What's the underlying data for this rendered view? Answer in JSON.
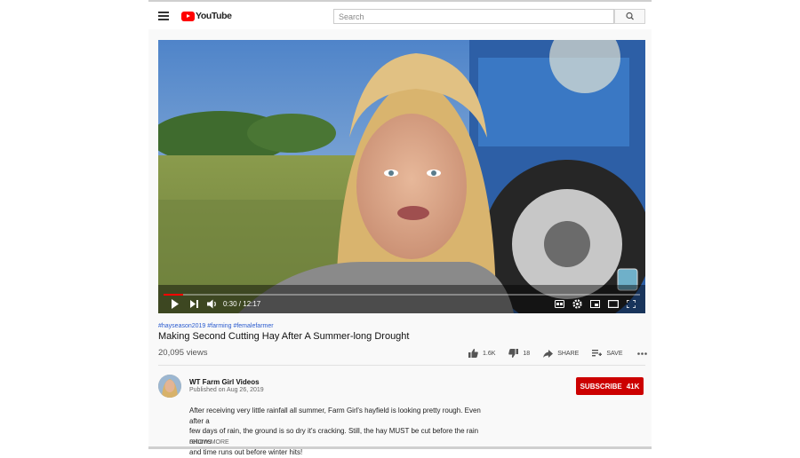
{
  "header": {
    "logo_text": "YouTube",
    "search_placeholder": "Search"
  },
  "player": {
    "time_display": "0:30 / 12:17",
    "progress_fraction": 0.041
  },
  "video": {
    "tags": "#hayseason2019 #farming #femalefarmer",
    "title": "Making Second Cutting Hay After A Summer-long Drought",
    "views": "20,095 views",
    "likes": "1.6K",
    "dislikes": "18",
    "share_label": "SHARE",
    "save_label": "SAVE"
  },
  "channel": {
    "name": "WT Farm Girl Videos",
    "published": "Published on Aug 26, 2019",
    "subscribe_label": "SUBSCRIBE",
    "subscriber_count": "41K"
  },
  "description": {
    "lines": [
      "After receiving very little rainfall all summer, Farm Girl's hayfield is looking pretty rough. Even after a",
      "few days of rain, the ground is so dry it's cracking. Still, the hay MUST be cut before the rain returns",
      "and time runs out before winter hits!"
    ],
    "show_more": "SHOW MORE"
  },
  "colors": {
    "brand_red": "#ff0000",
    "subscribe_red": "#cc0000",
    "tag_blue": "#2b5ccf"
  },
  "icons": [
    "menu-icon",
    "youtube-logo-icon",
    "search-icon",
    "play-icon",
    "next-icon",
    "volume-icon",
    "captions-icon",
    "settings-icon",
    "miniplayer-icon",
    "theater-icon",
    "fullscreen-icon",
    "thumb-up-icon",
    "thumb-down-icon",
    "share-icon",
    "save-icon",
    "more-icon"
  ]
}
